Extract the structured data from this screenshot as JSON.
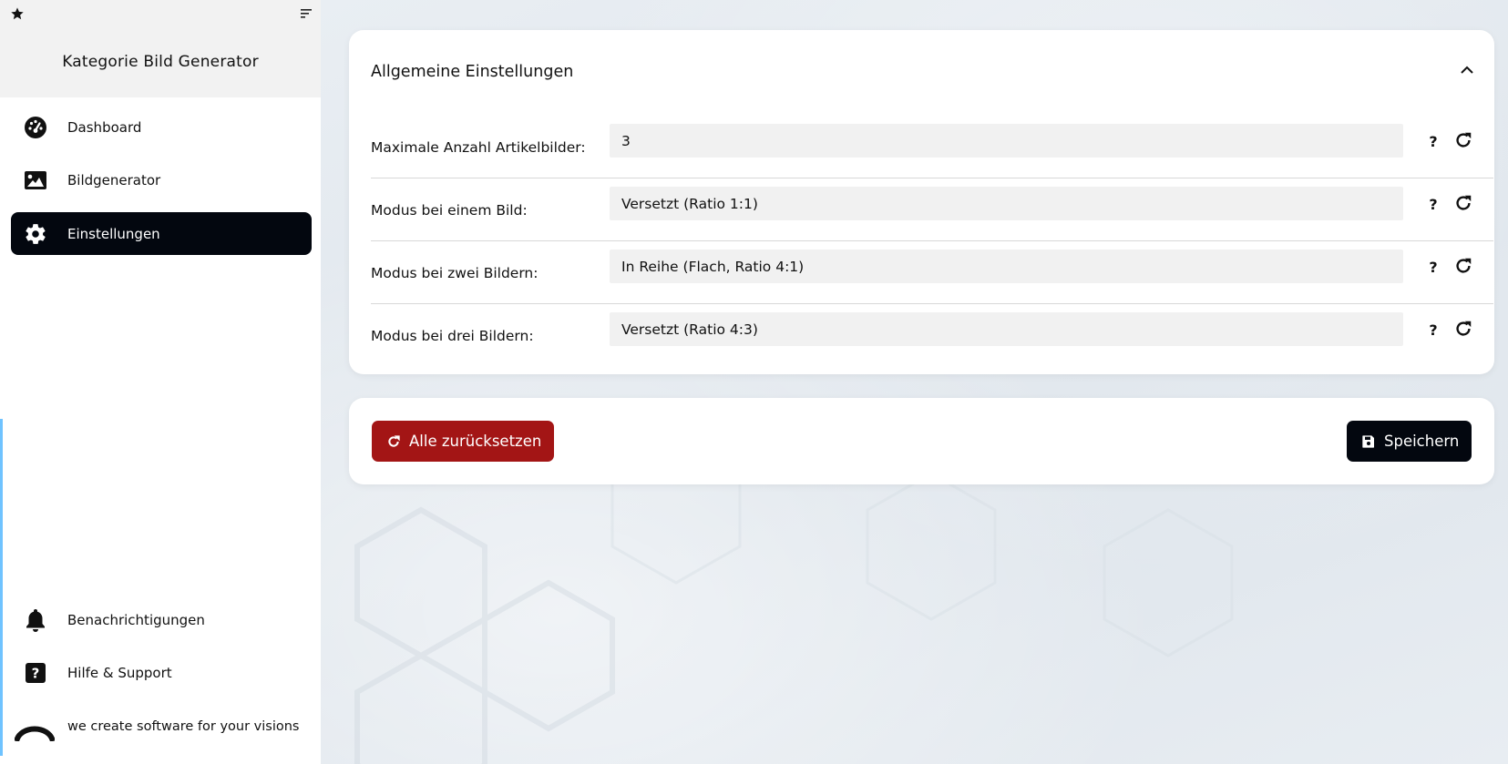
{
  "sidebar": {
    "title": "Kategorie Bild Generator",
    "nav": [
      {
        "label": "Dashboard",
        "icon": "dashboard-gauge-icon"
      },
      {
        "label": "Bildgenerator",
        "icon": "image-icon"
      },
      {
        "label": "Einstellungen",
        "icon": "gear-icon",
        "active": true
      }
    ],
    "bottom_nav": [
      {
        "label": "Benachrichtigungen",
        "icon": "bell-icon"
      },
      {
        "label": "Hilfe & Support",
        "icon": "help-square-icon"
      }
    ],
    "tagline": "we create software for your visions"
  },
  "settings": {
    "section_title": "Allgemeine Einstellungen",
    "rows": [
      {
        "label": "Maximale Anzahl Artikelbilder:",
        "value": "3"
      },
      {
        "label": "Modus bei einem Bild:",
        "value": "Versetzt (Ratio 1:1)"
      },
      {
        "label": "Modus bei zwei Bildern:",
        "value": "In Reihe (Flach, Ratio 4:1)"
      },
      {
        "label": "Modus bei drei Bildern:",
        "value": "Versetzt (Ratio 4:3)"
      }
    ],
    "help_symbol": "?"
  },
  "actions": {
    "reset_all_label": "Alle zurücksetzen",
    "save_label": "Speichern"
  },
  "colors": {
    "primary_dark": "#03070f",
    "danger": "#a31515",
    "sidebar_header_bg": "#f2f2f2",
    "input_bg": "#f1f1f1",
    "accent": "#6fc3ff"
  }
}
